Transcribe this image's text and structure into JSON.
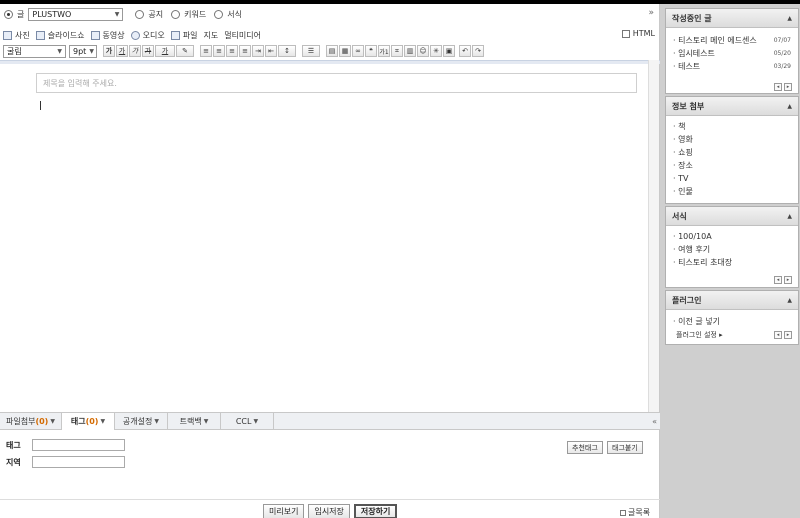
{
  "header": {
    "radio_post": "글",
    "category": "PLUSTWO",
    "radio_notice": "공지",
    "radio_keyword": "키워드",
    "radio_template": "서식",
    "collapse": "»"
  },
  "media_bar": {
    "photo": "사진",
    "slideshow": "슬라이드쇼",
    "video": "동영상",
    "audio": "오디오",
    "file": "파일",
    "map": "지도",
    "multimedia": "멀티미디어",
    "html_label": "HTML"
  },
  "format_bar": {
    "font": "굴림",
    "size": "9pt",
    "bold": "가",
    "underline": "가",
    "italic": "가",
    "strike": "가",
    "color": "가",
    "quote": "❝",
    "superscript": "가1"
  },
  "editor": {
    "title_placeholder": "제목을 입력해 주세요."
  },
  "bottom_tabs": {
    "attach_label": "파일첨부",
    "attach_count": "(0)",
    "tag_label": "태그",
    "tag_count": "(0)",
    "visibility": "공개설정",
    "trackback": "트랙백",
    "ccl": "CCL",
    "expand": "«"
  },
  "tag_panel": {
    "tag_label": "태그",
    "location_label": "지역",
    "recommend_btn": "추천태그",
    "cloud_btn": "태그붙기"
  },
  "actions": {
    "preview": "미리보기",
    "draft": "임시저장",
    "save": "저장하기",
    "list": "글목록"
  },
  "sidebar": {
    "writing": {
      "title": "작성중인 글",
      "items": [
        {
          "label": "· 티스토리 메인 에드센스",
          "date": "07/07"
        },
        {
          "label": "· 임시테스트",
          "date": "05/20"
        },
        {
          "label": "· 테스트",
          "date": "03/29"
        }
      ]
    },
    "info": {
      "title": "정보 첨부",
      "items": [
        "· 책",
        "· 영화",
        "· 쇼핑",
        "· 장소",
        "· TV",
        "· 인물"
      ]
    },
    "template": {
      "title": "서식",
      "items": [
        "· 100/10A",
        "· 여행 후기",
        "· 티스토리 초대장"
      ]
    },
    "plugin": {
      "title": "플러그인",
      "items": [
        "· 이전 글 넣기"
      ],
      "settings": "플러그인 설정 ▸"
    }
  },
  "colors": {
    "accent_count": "#d46a00",
    "sidebar_bg": "#cfcfcf"
  }
}
